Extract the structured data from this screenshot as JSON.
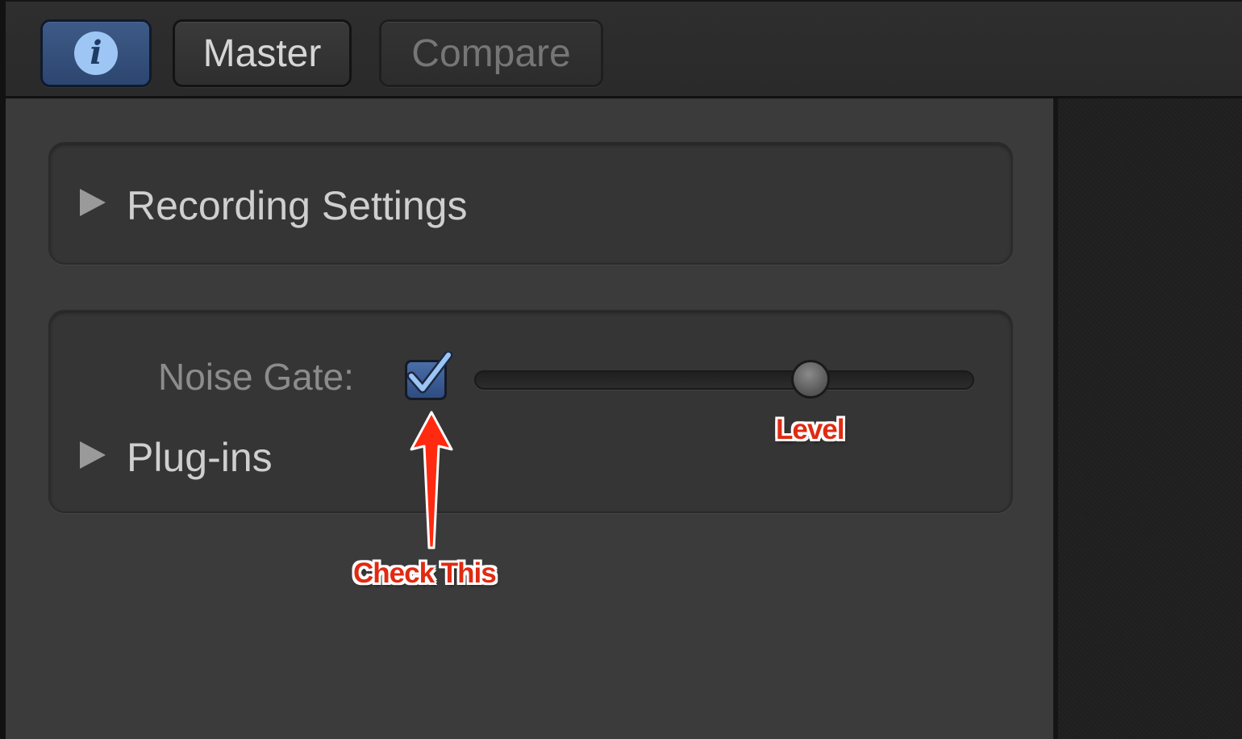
{
  "toolbar": {
    "info_glyph": "i",
    "master_label": "Master",
    "compare_label": "Compare"
  },
  "recording_settings": {
    "label": "Recording Settings",
    "expanded": false
  },
  "noise_gate": {
    "label": "Noise Gate:",
    "checked": true,
    "level": 0.68
  },
  "plugins": {
    "label": "Plug-ins",
    "expanded": false
  },
  "annotations": {
    "check_this": "Check This",
    "level": "Level"
  },
  "colors": {
    "accent_blue": "#3e5a86",
    "check_blue": "#8fb8f0",
    "annotation_red": "#e02a12"
  },
  "icons": {
    "info": "info-icon",
    "disclosure": "disclosure-triangle-icon",
    "checkmark": "checkmark-icon",
    "arrow": "arrow-up-icon"
  }
}
